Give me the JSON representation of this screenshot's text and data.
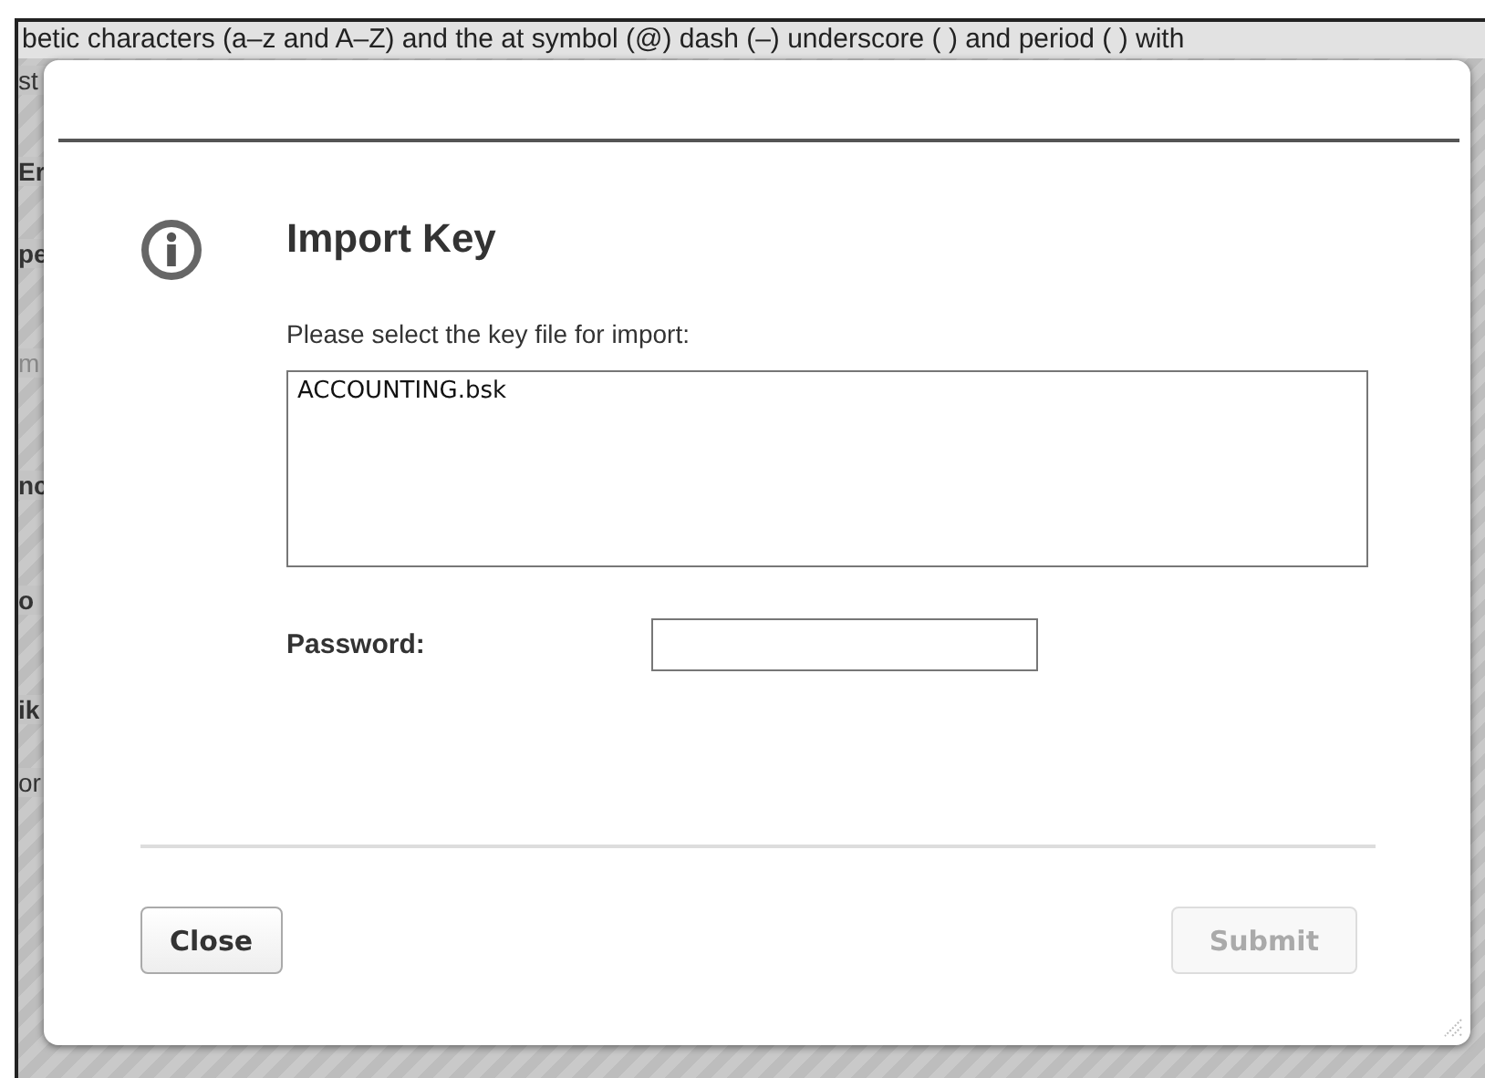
{
  "background_page": {
    "top_text": "betic characters (a–z and A–Z)  and the at symbol (@)  dash (–)  underscore (  )  and period (  ) with",
    "left_fragments": [
      {
        "text": "st",
        "kind": "plain"
      },
      {
        "text": "Er",
        "kind": "bold"
      },
      {
        "text": "pe",
        "kind": "bold"
      },
      {
        "text": "m",
        "kind": "muted"
      },
      {
        "text": "nc",
        "kind": "bold"
      },
      {
        "text": "o",
        "kind": "bold"
      },
      {
        "text": "ik",
        "kind": "bold"
      },
      {
        "text": "or",
        "kind": "plain"
      }
    ]
  },
  "dialog": {
    "title": "Import Key",
    "prompt": "Please select the key file for import:",
    "files": [
      {
        "name": "ACCOUNTING.bsk",
        "selected": false
      }
    ],
    "password": {
      "label": "Password:"
    },
    "buttons": [
      {
        "label": "Close",
        "disabled": false
      },
      {
        "label": "Submit",
        "disabled": true
      }
    ]
  }
}
